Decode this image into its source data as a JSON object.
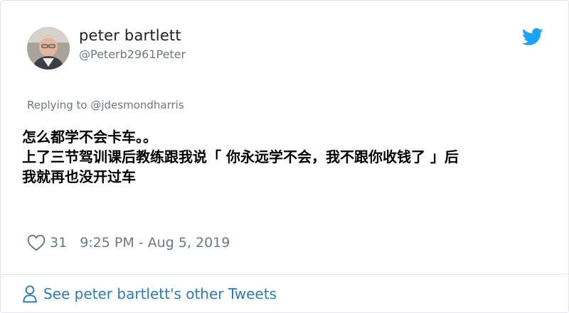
{
  "author": {
    "name": "peter bartlett",
    "handle": "@Peterb2961Peter"
  },
  "reply": {
    "prefix": "Replying to ",
    "mention": "@jdesmondharris"
  },
  "tweet": {
    "lines": [
      "怎么都学不会卡车。。",
      "上了三节驾训课后教练跟我说「 你永远学不会，我不跟你收钱了 」后",
      "我就再也没开过车"
    ]
  },
  "meta": {
    "like_count": "31",
    "timestamp": "9:25 PM - Aug 5, 2019"
  },
  "footer": {
    "see_more": "See peter bartlett's other Tweets"
  },
  "icons": {
    "brand": "twitter-bird-icon",
    "like": "heart-icon",
    "person": "person-icon"
  },
  "colors": {
    "twitter_blue": "#1da1f2",
    "link_blue": "#2b7bb9",
    "muted_gray": "#697882"
  }
}
